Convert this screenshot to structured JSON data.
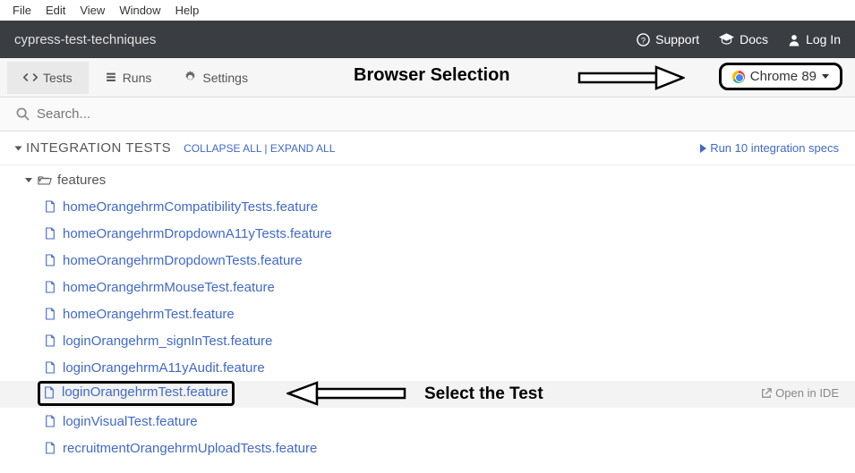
{
  "menubar": [
    "File",
    "Edit",
    "View",
    "Window",
    "Help"
  ],
  "header": {
    "project": "cypress-test-techniques",
    "support": "Support",
    "docs": "Docs",
    "login": "Log In"
  },
  "tabs": {
    "tests": "Tests",
    "runs": "Runs",
    "settings": "Settings"
  },
  "annotations": {
    "browser_selection": "Browser Selection",
    "select_the_test": "Select the Test"
  },
  "browser": {
    "label": "Chrome 89"
  },
  "search": {
    "placeholder": "Search..."
  },
  "section": {
    "title": "INTEGRATION TESTS",
    "collapse": "COLLAPSE ALL",
    "separator": " | ",
    "expand": "EXPAND ALL",
    "run_label": "Run 10 integration specs"
  },
  "folder": {
    "name": "features"
  },
  "files": [
    "homeOrangehrmCompatibilityTests.feature",
    "homeOrangehrmDropdownA11yTests.feature",
    "homeOrangehrmDropdownTests.feature",
    "homeOrangehrmMouseTest.feature",
    "homeOrangehrmTest.feature",
    "loginOrangehrm_signInTest.feature",
    "loginOrangehrmA11yAudit.feature",
    "loginOrangehrmTest.feature",
    "loginVisualTest.feature",
    "recruitmentOrangehrmUploadTests.feature"
  ],
  "highlighted_index": 7,
  "open_ide": "Open in IDE"
}
